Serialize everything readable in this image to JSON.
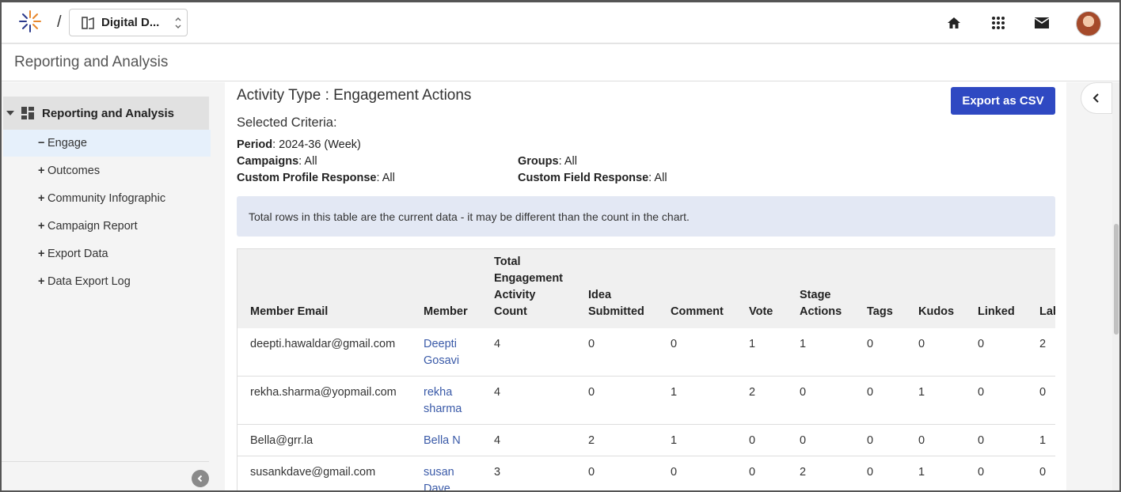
{
  "topbar": {
    "workspace_label": "Digital D...",
    "icons": [
      "logo-icon",
      "home-icon",
      "apps-grid-icon",
      "mail-icon",
      "avatar"
    ]
  },
  "page_header": {
    "title": "Reporting and Analysis"
  },
  "sidebar": {
    "header_label": "Reporting and Analysis",
    "items": [
      {
        "sign": "−",
        "label": "Engage",
        "active": true
      },
      {
        "sign": "+",
        "label": "Outcomes"
      },
      {
        "sign": "+",
        "label": "Community Infographic"
      },
      {
        "sign": "+",
        "label": "Campaign Report"
      },
      {
        "sign": "+",
        "label": "Export Data"
      },
      {
        "sign": "+",
        "label": "Data Export Log"
      }
    ]
  },
  "main": {
    "activity_type": "Activity Type : Engagement Actions",
    "export_label": "Export as CSV",
    "criteria_title": "Selected Criteria:",
    "criteria": {
      "period_label": "Period",
      "period_value": ": 2024-36 (Week)",
      "campaigns_label": "Campaigns",
      "campaigns_value": ": All",
      "groups_label": "Groups",
      "groups_value": ": All",
      "profile_label": "Custom Profile Response",
      "profile_value": ": All",
      "field_label": "Custom Field Response",
      "field_value": ": All"
    },
    "notice": "Total rows in this table are the current data - it may be different than the count in the chart.",
    "table": {
      "headers": [
        "Member Email",
        "Member",
        "Total Engagement Activity Count",
        "Idea Submitted",
        "Comment",
        "Vote",
        "Stage Actions",
        "Tags",
        "Kudos",
        "Linked",
        "Lab"
      ],
      "rows": [
        [
          "deepti.hawaldar@gmail.com",
          "Deepti Gosavi",
          "4",
          "0",
          "0",
          "1",
          "1",
          "0",
          "0",
          "0",
          "2"
        ],
        [
          "rekha.sharma@yopmail.com",
          "rekha sharma",
          "4",
          "0",
          "1",
          "2",
          "0",
          "0",
          "1",
          "0",
          "0"
        ],
        [
          "Bella@grr.la",
          "Bella N",
          "4",
          "2",
          "1",
          "0",
          "0",
          "0",
          "0",
          "0",
          "1"
        ],
        [
          "susankdave@gmail.com",
          "susan Dave",
          "3",
          "0",
          "0",
          "0",
          "2",
          "0",
          "1",
          "0",
          "0"
        ]
      ]
    }
  },
  "colors": {
    "primary_button": "#2f49c2",
    "link": "#3a5aa8",
    "notice_bg": "#e3e8f4",
    "active_item_bg": "#e6f0fb"
  }
}
